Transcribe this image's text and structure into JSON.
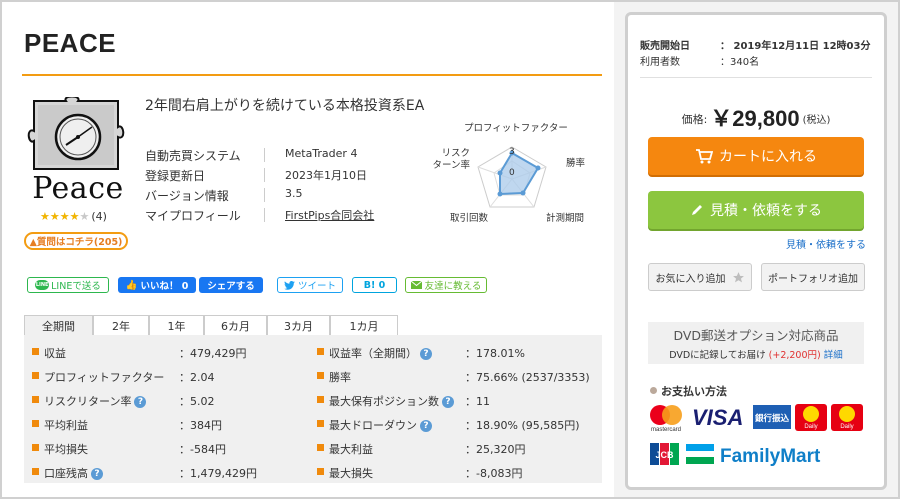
{
  "product": {
    "title": "PEACE",
    "logo_word": "Peace",
    "rating_count": "(4)",
    "review_button": "▲質問はコチラ(205)",
    "description": "2年間右肩上がりを続けている本格投資系EA",
    "rating": 4,
    "rating_max": 5
  },
  "info": [
    {
      "key": "自動売買システム",
      "value": "MetaTrader 4"
    },
    {
      "key": "登録更新日",
      "value": "2023年1月10日"
    },
    {
      "key": "バージョン情報",
      "value": "3.5"
    },
    {
      "key": "マイプロフィール",
      "value": "FirstPips合同会社"
    }
  ],
  "radar": {
    "labels": {
      "pf": "プロフィットファクター",
      "win": "勝率",
      "period": "計測期間",
      "trades": "取引回数",
      "risk": "リスク\nターン率"
    },
    "scale_top": "3",
    "scale_zero": "0"
  },
  "share": {
    "line": "LINEで送る",
    "line_icon": "LINE",
    "like": "いいね！ 0",
    "fb_share": "シェアする",
    "tweet": "ツイート",
    "hatena": "B! 0",
    "mail": "友達に教える"
  },
  "tabs": [
    "全期間",
    "2年",
    "1年",
    "6カ月",
    "3カ月",
    "1カ月"
  ],
  "stats_left": [
    {
      "key": "収益",
      "value": "：479,429円",
      "help": false
    },
    {
      "key": "プロフィットファクター",
      "value": "：2.04",
      "help": false
    },
    {
      "key": "リスクリターン率",
      "value": "：5.02",
      "help": true
    },
    {
      "key": "平均利益",
      "value": "：384円",
      "help": false
    },
    {
      "key": "平均損失",
      "value": "：-584円",
      "help": false
    },
    {
      "key": "口座残高",
      "value": "：1,479,429円",
      "help": true
    }
  ],
  "stats_right": [
    {
      "key": "収益率（全期間）",
      "value": "：178.01%",
      "help": true
    },
    {
      "key": "勝率",
      "value": "：75.66% (2537/3353)",
      "help": false
    },
    {
      "key": "最大保有ポジション数",
      "value": "：11",
      "help": true
    },
    {
      "key": "最大ドローダウン",
      "value": "：18.90% (95,585円)",
      "help": true
    },
    {
      "key": "最大利益",
      "value": "：25,320円",
      "help": false
    },
    {
      "key": "最大損失",
      "value": "：-8,083円",
      "help": false
    }
  ],
  "sidebar": {
    "sale_start_label": "販売開始日",
    "sale_start_value": "：  2019年12月11日 12時03分",
    "users_label": "利用者数",
    "users_value": "：340名",
    "price_label": "価格:",
    "price_value": "￥29,800",
    "price_tax": "(税込)",
    "cart_button": "カートに入れる",
    "quote_button": "見積・依頼をする",
    "quote_link": "見積・依頼をする",
    "fav_button": "お気に入り追加",
    "portfolio_button": "ポートフォリオ追加",
    "dvd_title": "DVD郵送オプション対応商品",
    "dvd_text": "DVDに記録してお届け",
    "dvd_price": "(+2,200円)",
    "dvd_link": "詳細",
    "payment_title": "お支払い方法",
    "pay_master_word": "mastercard",
    "pay_visa": "VISA",
    "pay_bank": "銀行振込",
    "pay_daily": "Daily",
    "pay_jcb": "JCB",
    "pay_familymart": "FamilyMart"
  },
  "colors": {
    "accent_orange": "#f39c12",
    "cart_orange": "#f5870f",
    "quote_green": "#8cc63f",
    "link_blue": "#1a6fc9",
    "facebook_blue": "#1877f2"
  }
}
